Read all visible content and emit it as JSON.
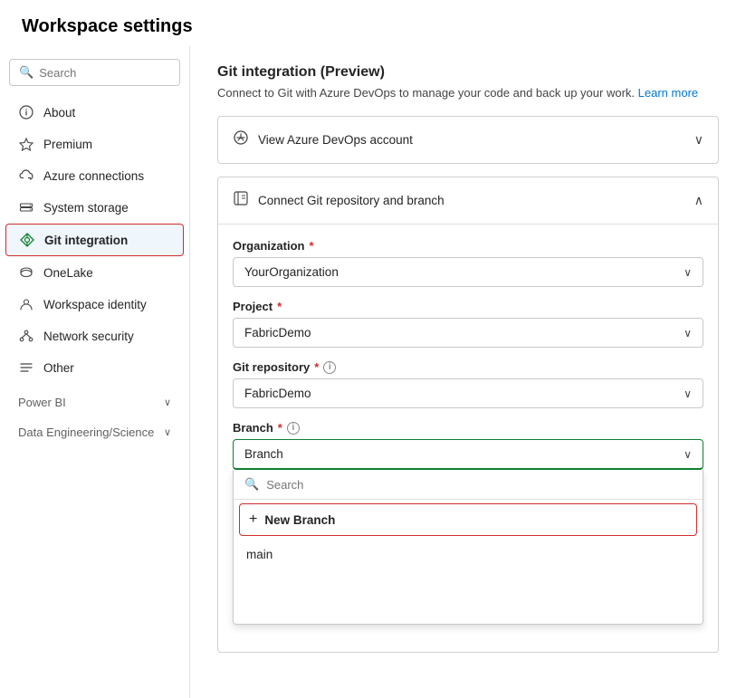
{
  "page": {
    "title": "Workspace settings"
  },
  "sidebar": {
    "search_placeholder": "Search",
    "items": [
      {
        "id": "about",
        "label": "About",
        "icon": "info"
      },
      {
        "id": "premium",
        "label": "Premium",
        "icon": "gem"
      },
      {
        "id": "azure-connections",
        "label": "Azure connections",
        "icon": "cloud"
      },
      {
        "id": "system-storage",
        "label": "System storage",
        "icon": "hdd"
      },
      {
        "id": "git-integration",
        "label": "Git integration",
        "icon": "git",
        "active": true
      },
      {
        "id": "onelake",
        "label": "OneLake",
        "icon": "lake"
      },
      {
        "id": "workspace-identity",
        "label": "Workspace identity",
        "icon": "identity"
      },
      {
        "id": "network-security",
        "label": "Network security",
        "icon": "network"
      },
      {
        "id": "other",
        "label": "Other",
        "icon": "list"
      }
    ],
    "sections": [
      {
        "id": "power-bi",
        "label": "Power BI",
        "expanded": false
      },
      {
        "id": "data-engineering",
        "label": "Data Engineering/Science",
        "expanded": false
      }
    ]
  },
  "content": {
    "title": "Git integration (Preview)",
    "subtitle": "Connect to Git with Azure DevOps to manage your code and back up your work.",
    "learn_more": "Learn more",
    "panel1": {
      "label": "View Azure DevOps account",
      "chevron": "expand"
    },
    "panel2": {
      "label": "Connect Git repository and branch",
      "chevron": "collapse",
      "fields": [
        {
          "id": "organization",
          "label": "Organization",
          "required": true,
          "value": "YourOrganization"
        },
        {
          "id": "project",
          "label": "Project",
          "required": true,
          "value": "FabricDemo"
        },
        {
          "id": "git-repository",
          "label": "Git repository",
          "required": true,
          "has_info": true,
          "value": "FabricDemo"
        },
        {
          "id": "branch",
          "label": "Branch",
          "required": true,
          "has_info": true,
          "value": "Branch",
          "open": true
        }
      ]
    },
    "branch_dropdown": {
      "search_placeholder": "Search",
      "new_branch_label": "New Branch",
      "items": [
        "main"
      ]
    }
  }
}
